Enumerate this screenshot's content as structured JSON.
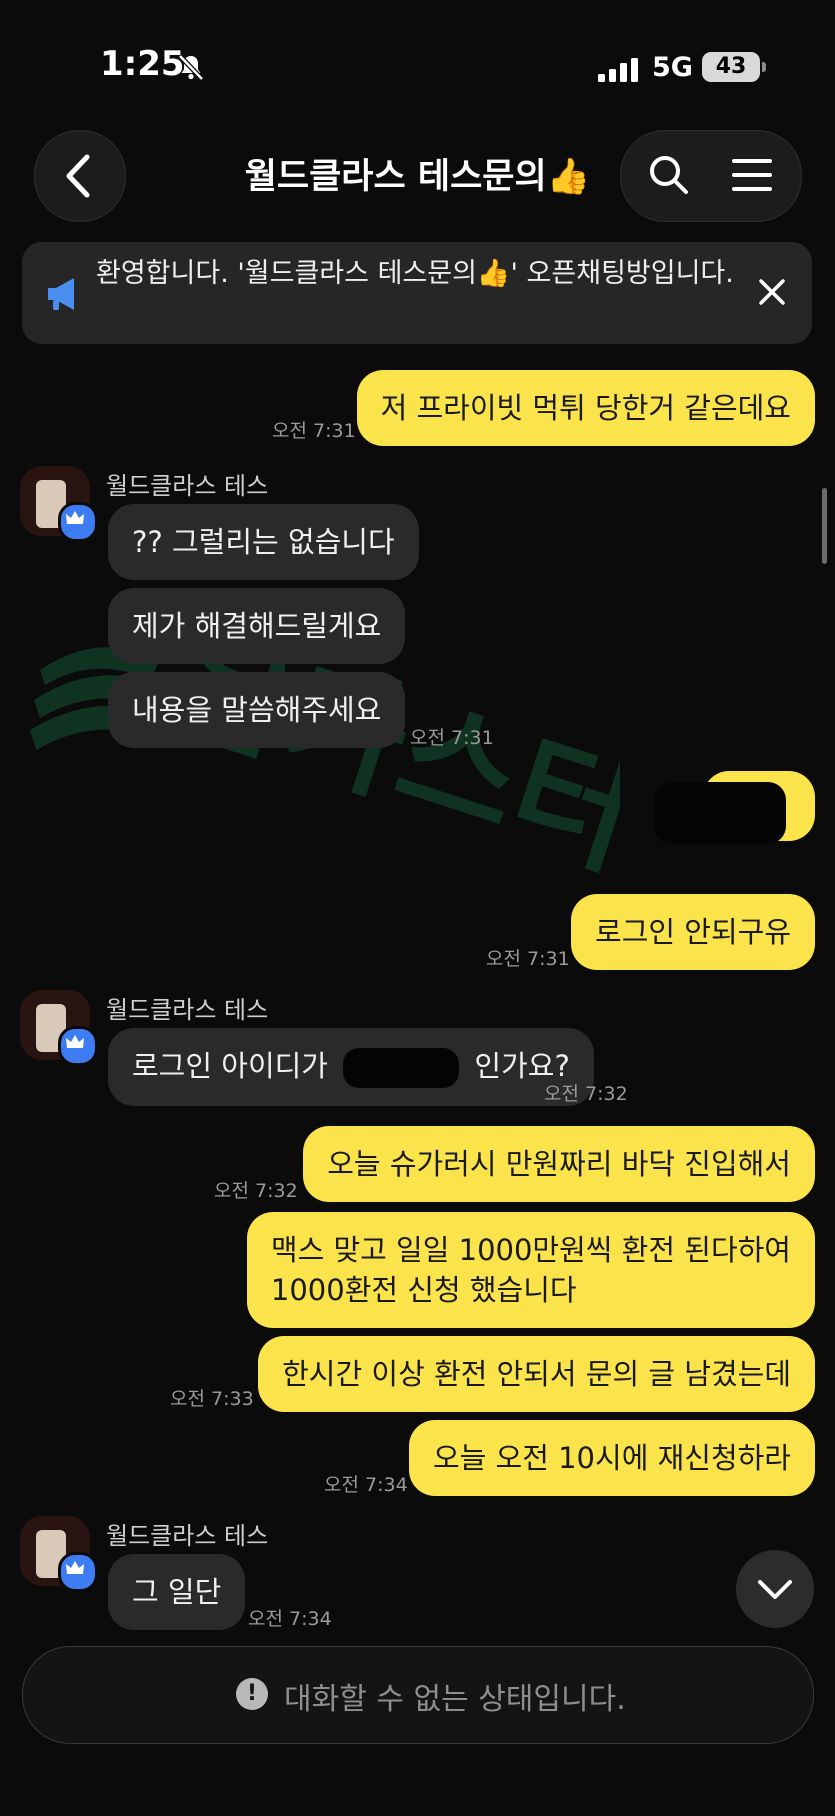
{
  "status_bar": {
    "time": "1:25",
    "network": "5G",
    "battery": "43"
  },
  "header": {
    "title": "월드클라스 테스문의👍"
  },
  "notice": {
    "text": "환영합니다. '월드클라스 테스문의👍' 오픈채팅방입니다."
  },
  "messages": {
    "m1": {
      "text": "저 프라이빗 먹튀 당한거 같은데요",
      "time": "오전 7:31"
    },
    "s1": {
      "sender": "월드클라스 테스"
    },
    "m2": {
      "text": "?? 그럴리는 없습니다"
    },
    "m3": {
      "text": "제가 해결해드릴게요"
    },
    "m4": {
      "text": "내용을 말씀해주세요",
      "time": "오전 7:31"
    },
    "m6": {
      "text": "로그인 안되구유",
      "time": "오전 7:31"
    },
    "s2": {
      "sender": "월드클라스 테스"
    },
    "m7": {
      "prefix": "로그인 아이디가",
      "suffix": "인가요?",
      "time": "오전 7:32"
    },
    "m8": {
      "text": "오늘 슈가러시 만원짜리 바닥 진입해서",
      "time": "오전 7:32"
    },
    "m9": {
      "line1": "맥스 맞고 일일 1000만원씩 환전 된다하여",
      "line2": "1000환전 신청 했습니다"
    },
    "m10": {
      "text": "한시간 이상 환전 안되서 문의 글 남겼는데",
      "time": "오전 7:33"
    },
    "m11": {
      "text": "오늘 오전 10시에 재신청하라",
      "time": "오전 7:34"
    },
    "s3": {
      "sender": "월드클라스 테스"
    },
    "m12": {
      "text": "그 일단",
      "time": "오전 7:34"
    }
  },
  "input": {
    "disabled_text": "대화할 수 없는 상태입니다."
  },
  "colors": {
    "my_bubble": "#fbe44b",
    "their_bubble": "#2a2a2a",
    "background": "#0b0b0b",
    "badge_blue": "#3d7cf2"
  }
}
